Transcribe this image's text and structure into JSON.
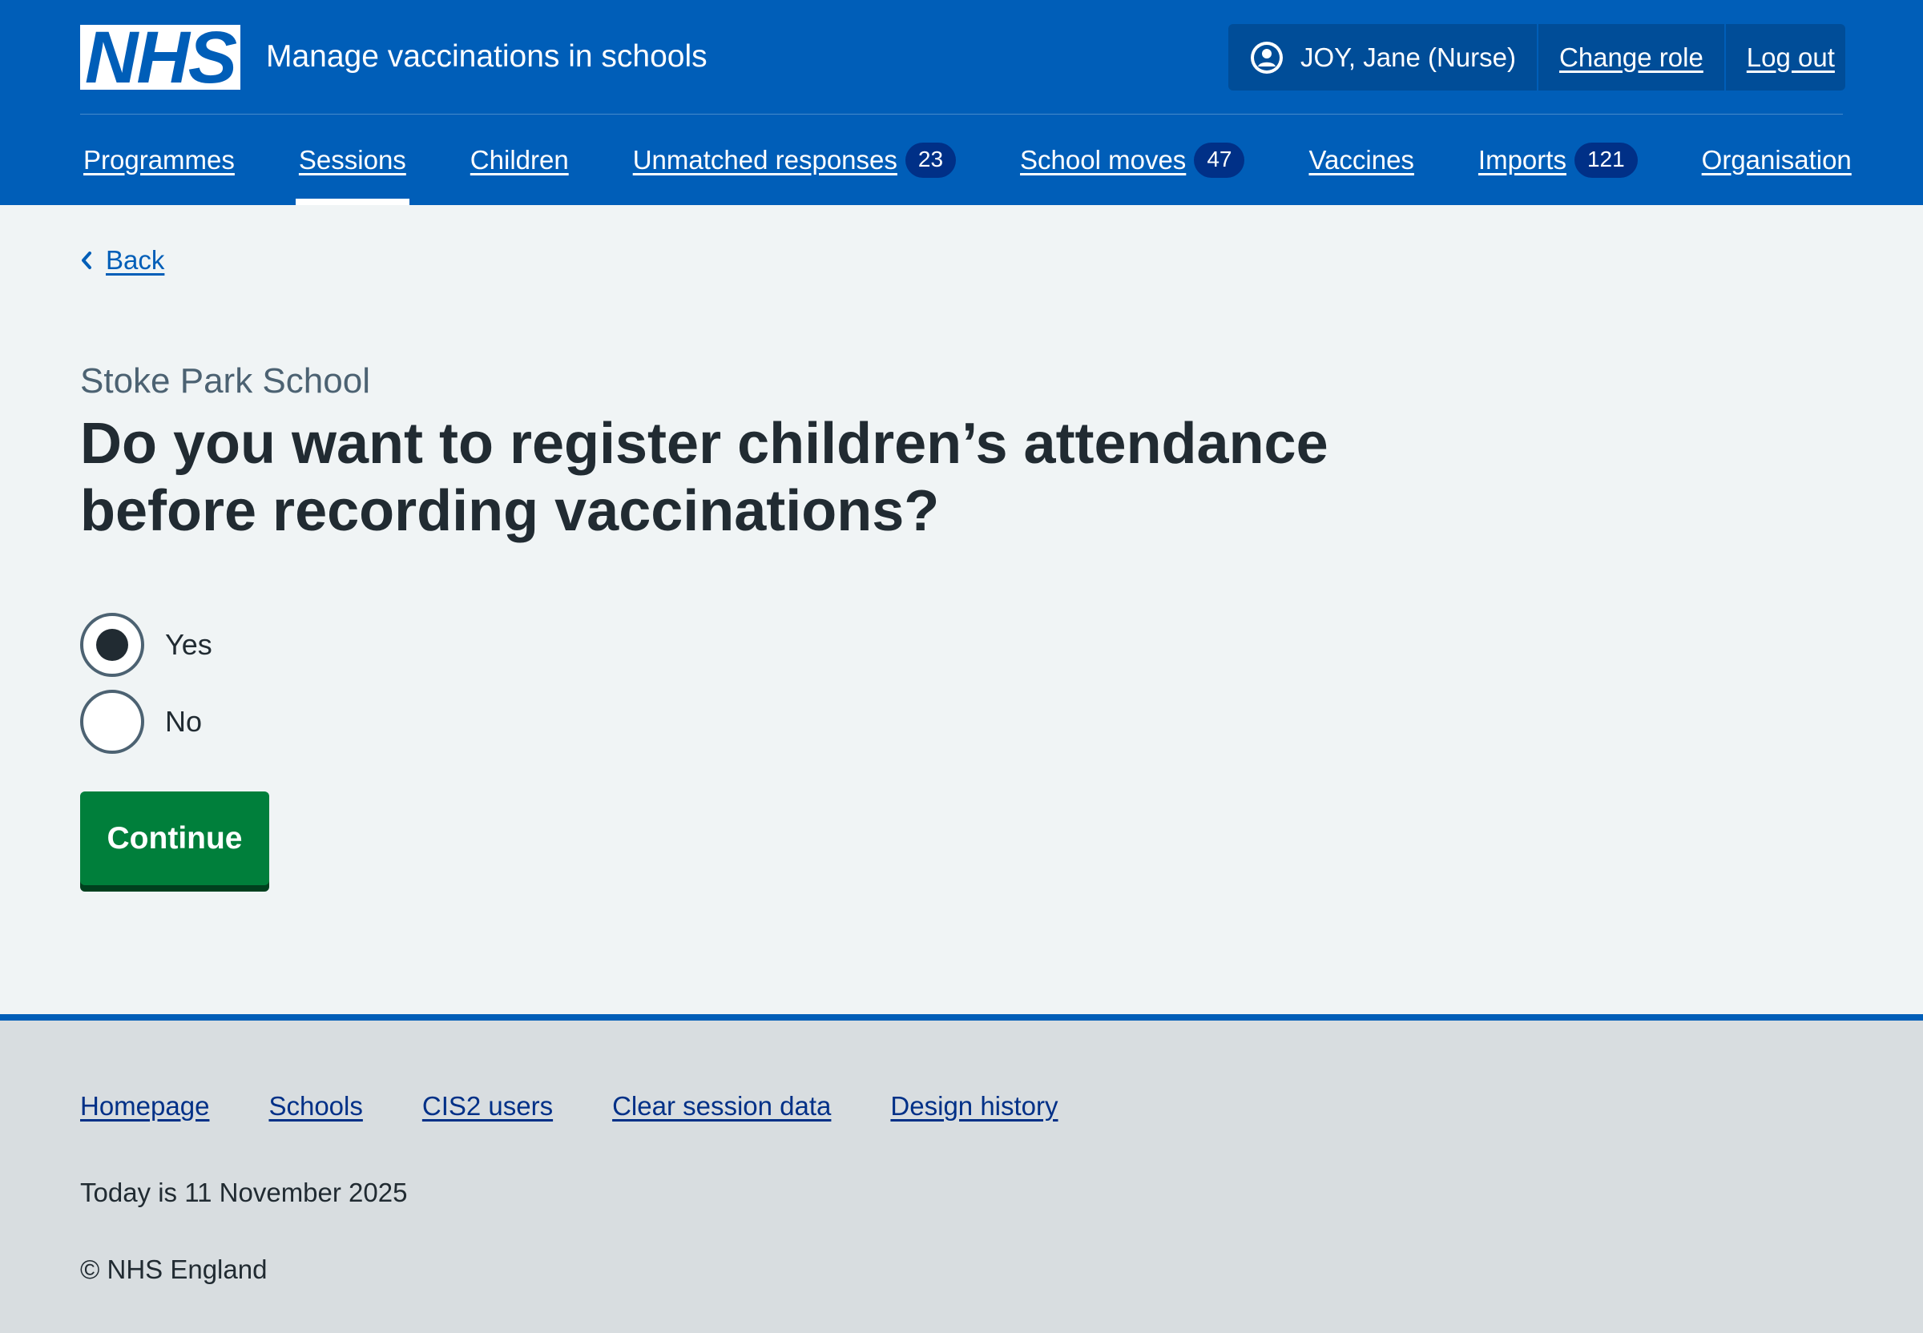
{
  "header": {
    "logo_text": "NHS",
    "service_name": "Manage vaccinations in schools",
    "account": {
      "user": "JOY, Jane (Nurse)",
      "change_role": "Change role",
      "log_out": "Log out"
    },
    "nav": [
      {
        "label": "Programmes",
        "badge": null,
        "current": false
      },
      {
        "label": "Sessions",
        "badge": null,
        "current": true
      },
      {
        "label": "Children",
        "badge": null,
        "current": false
      },
      {
        "label": "Unmatched responses",
        "badge": "23",
        "current": false
      },
      {
        "label": "School moves",
        "badge": "47",
        "current": false
      },
      {
        "label": "Vaccines",
        "badge": null,
        "current": false
      },
      {
        "label": "Imports",
        "badge": "121",
        "current": false
      },
      {
        "label": "Organisation",
        "badge": null,
        "current": false
      }
    ]
  },
  "main": {
    "back_label": "Back",
    "caption": "Stoke Park School",
    "question": "Do you want to register children’s attendance before recording vaccinations?",
    "options": [
      {
        "label": "Yes",
        "checked": true
      },
      {
        "label": "No",
        "checked": false
      }
    ],
    "continue_label": "Continue"
  },
  "footer": {
    "links": [
      "Homepage",
      "Schools",
      "CIS2 users",
      "Clear session data",
      "Design history"
    ],
    "today": "Today is 11 November 2025",
    "copyright": "© NHS England"
  },
  "colors": {
    "brand_blue": "#005eb8",
    "dark_blue": "#003087",
    "button_green": "#007f3b",
    "page_bg": "#f0f4f5",
    "footer_bg": "#d8dde0"
  }
}
